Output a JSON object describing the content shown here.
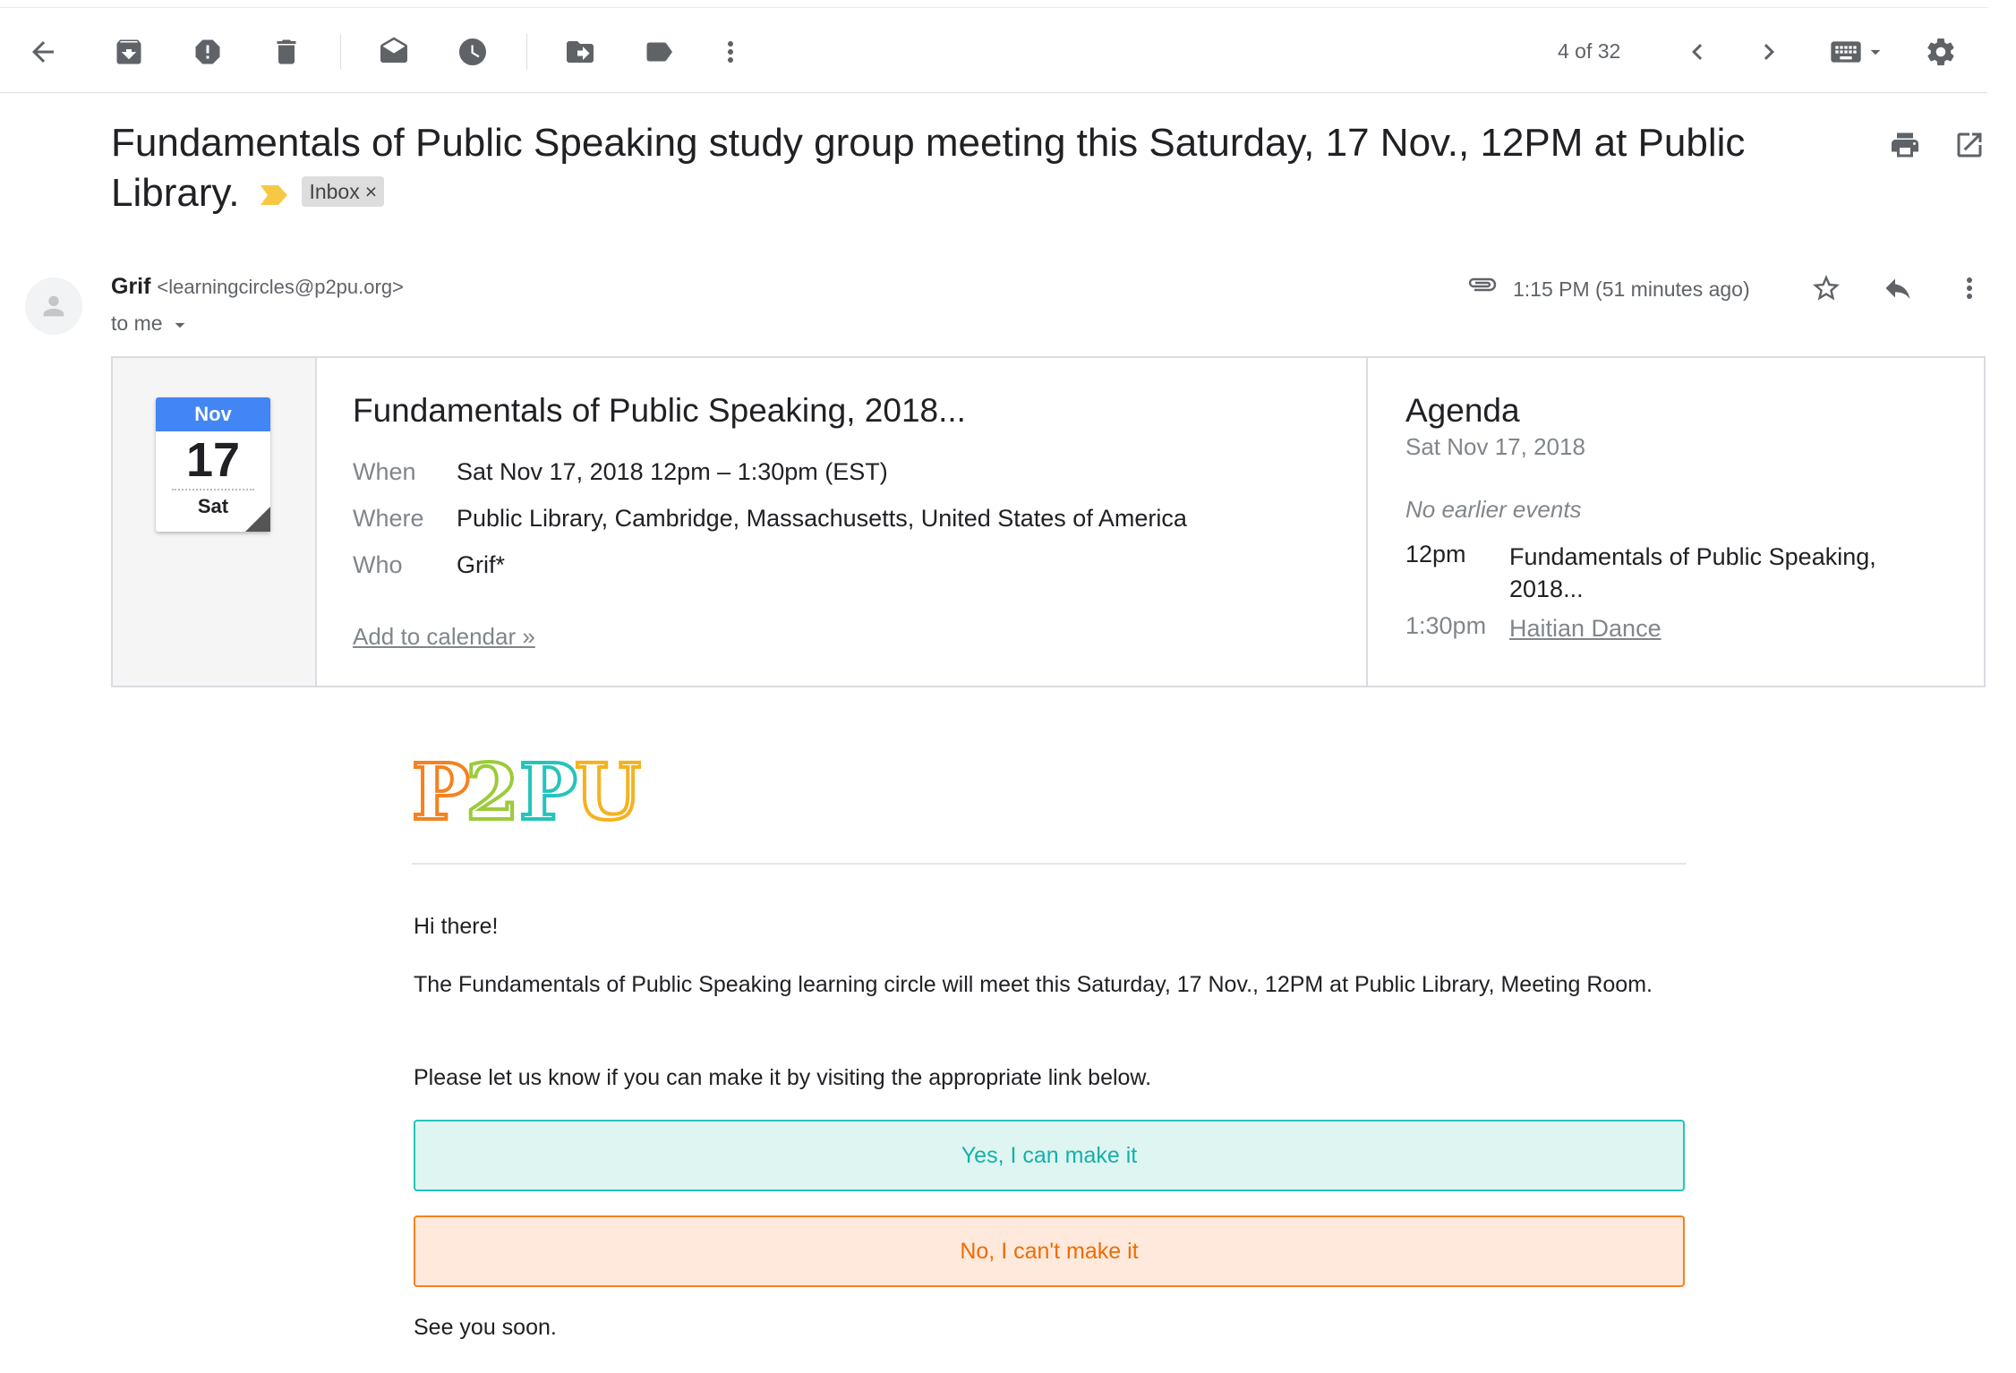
{
  "toolbar": {
    "back_icon": "arrow-left-icon",
    "counter": "4 of 32"
  },
  "message": {
    "subject": "Fundamentals of Public Speaking study group meeting this Saturday, 17 Nov., 12PM at Public Library.",
    "label_chip": "Inbox",
    "chip_close": "×",
    "sender_name": "Grif",
    "sender_email": "<learningcircles@p2pu.org>",
    "to": "to me",
    "time": "1:15 PM (51 minutes ago)"
  },
  "invite": {
    "calendar": {
      "month": "Nov",
      "day": "17",
      "weekday": "Sat"
    },
    "title": "Fundamentals of Public Speaking, 2018...",
    "when_label": "When",
    "when": "Sat Nov 17, 2018 12pm – 1:30pm (EST)",
    "where_label": "Where",
    "where": "Public Library, Cambridge, Massachusetts, United States of America",
    "who_label": "Who",
    "who": "Grif*",
    "add_to_calendar": "Add to calendar »",
    "agenda": {
      "title": "Agenda",
      "date": "Sat Nov 17, 2018",
      "none_earlier": "No earlier events",
      "items": [
        {
          "time": "12pm",
          "event": "Fundamentals of Public Speaking, 2018..."
        },
        {
          "time": "1:30pm",
          "event": "Haitian Dance"
        }
      ]
    }
  },
  "email_body": {
    "logo": "P2PU",
    "greeting": "Hi there!",
    "paragraph1": "The Fundamentals of Public Speaking learning circle will meet this Saturday, 17 Nov., 12PM at Public Library, Meeting Room.",
    "paragraph2": "Please let us know if you can make it by visiting the appropriate link below.",
    "yes_button": "Yes, I can make it",
    "no_button": "No, I can't make it",
    "closing": "See you soon."
  },
  "colors": {
    "accent_blue": "#4285f4",
    "yes_teal": "#25c4ba",
    "no_orange": "#f5821f",
    "label_yellow": "#f6c945"
  }
}
